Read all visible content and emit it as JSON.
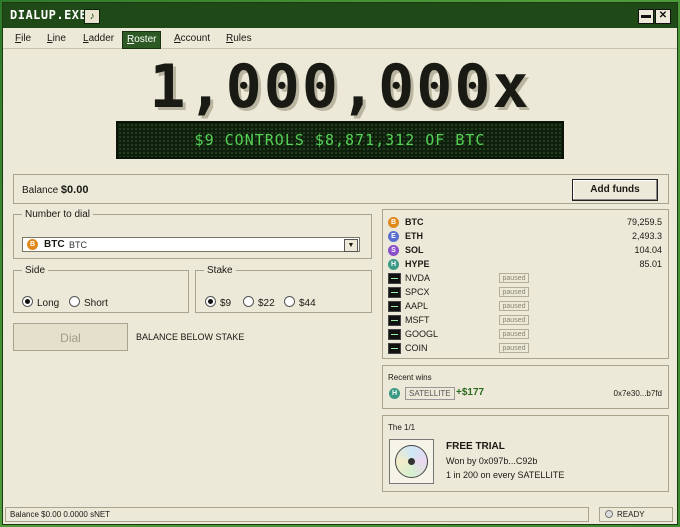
{
  "window": {
    "title": "DIALUP.EXE",
    "minimize": "▬",
    "close": "✕"
  },
  "menu": [
    {
      "prefix": "F",
      "rest": "ile",
      "label": "File"
    },
    {
      "prefix": "L",
      "rest": "ine",
      "label": "Line"
    },
    {
      "prefix": "L",
      "rest": "adder",
      "label": "Ladder"
    },
    {
      "prefix": "R",
      "rest": "oster",
      "label": "Roster"
    },
    {
      "prefix": "A",
      "rest": "ccount",
      "label": "Account"
    },
    {
      "prefix": "R",
      "rest": "ules",
      "label": "Rules"
    }
  ],
  "active_menu": "Roster",
  "headline": {
    "multiplier": "1,000,000x",
    "ticker": "$9 CONTROLS $8,871,312 OF BTC"
  },
  "balance": {
    "label": "Balance",
    "value": "$0.00",
    "add_funds": "Add funds"
  },
  "dial": {
    "legend": "Number to dial",
    "selected_symbol": "BTC",
    "selected_name": "BTC",
    "selected_icon": "B",
    "arrow": "▼"
  },
  "side": {
    "legend": "Side",
    "options": [
      "Long",
      "Short"
    ],
    "selected": "Long"
  },
  "stake": {
    "legend": "Stake",
    "options": [
      "$9",
      "$22",
      "$44"
    ],
    "selected": "$9"
  },
  "dial_button": {
    "label": "Dial",
    "status": "BALANCE BELOW STAKE"
  },
  "roster": {
    "crypto": [
      {
        "symbol": "BTC",
        "price": "79,259.5",
        "icon": "B",
        "color": "#e08a1e"
      },
      {
        "symbol": "ETH",
        "price": "2,493.3",
        "icon": "E",
        "color": "#5a6fd0"
      },
      {
        "symbol": "SOL",
        "price": "104.04",
        "icon": "S",
        "color": "#8a4fc8"
      },
      {
        "symbol": "HYPE",
        "price": "85.01",
        "icon": "H",
        "color": "#3a9a86"
      }
    ],
    "stocks": [
      {
        "symbol": "NVDA",
        "status": "paused"
      },
      {
        "symbol": "SPCX",
        "status": "paused"
      },
      {
        "symbol": "AAPL",
        "status": "paused"
      },
      {
        "symbol": "MSFT",
        "status": "paused"
      },
      {
        "symbol": "GOOGL",
        "status": "paused"
      },
      {
        "symbol": "COIN",
        "status": "paused"
      }
    ]
  },
  "recent_wins": {
    "title": "Recent wins",
    "icon": "H",
    "tag": "SATELLITE",
    "amount": "+$177",
    "address": "0x7e30...b7fd"
  },
  "one_of_one": {
    "title": "The 1/1",
    "name": "FREE TRIAL",
    "won_by": "Won by 0x097b...C92b",
    "odds": "1 in 200 on every SATELLITE"
  },
  "status_bar": {
    "left": "Balance $0.00 0.0000 sNET",
    "right": "READY"
  }
}
